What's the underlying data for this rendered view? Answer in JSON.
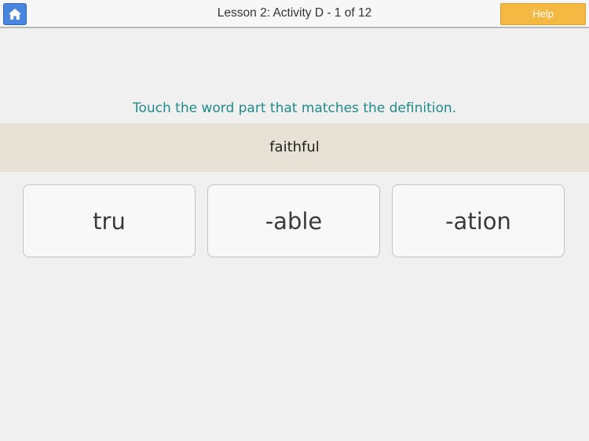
{
  "header": {
    "title": "Lesson 2:  Activity D - 1 of 12",
    "help_label": "Help",
    "home_icon": "home-icon"
  },
  "instruction": "Touch the word part that matches the definition.",
  "definition": "faithful",
  "choices": [
    {
      "label": "tru"
    },
    {
      "label": "-able"
    },
    {
      "label": "-ation"
    }
  ],
  "colors": {
    "home_button": "#4a86e0",
    "help_button": "#f4b942",
    "instruction_text": "#1f8a8a",
    "definition_band": "#e8e2d6",
    "background": "#f0f0f0"
  }
}
